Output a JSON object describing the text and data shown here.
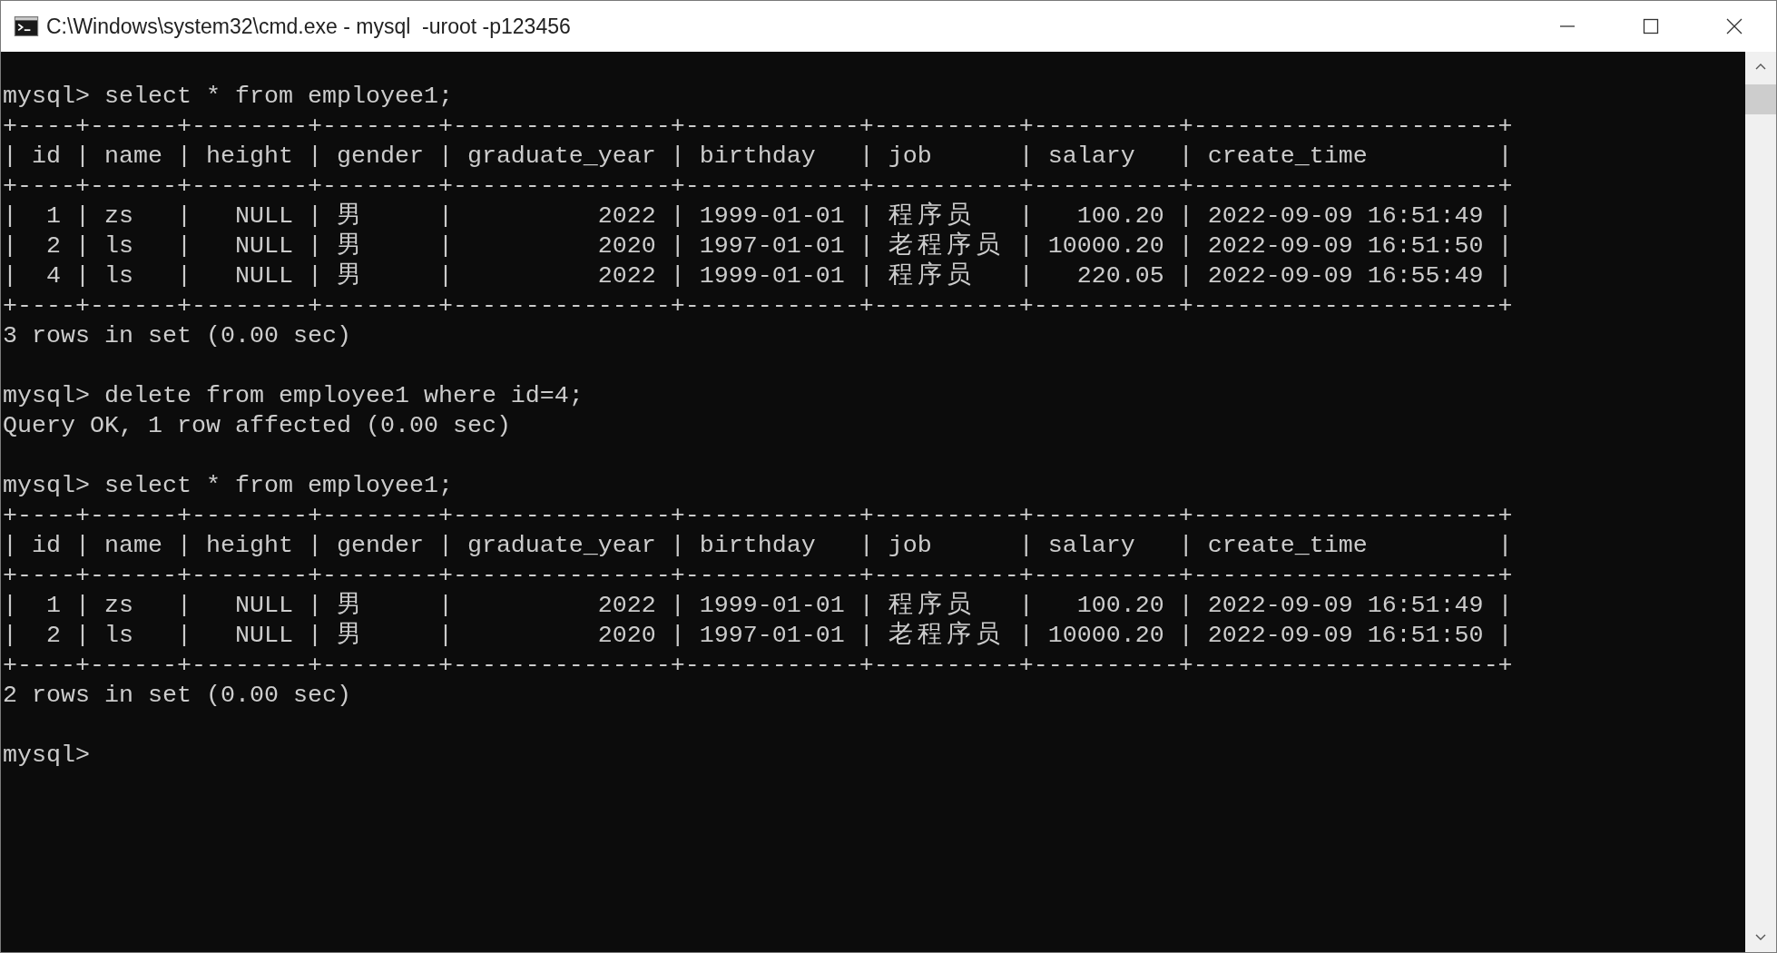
{
  "window": {
    "title": "C:\\Windows\\system32\\cmd.exe - mysql  -uroot -p123456"
  },
  "terminal": {
    "blocks": [
      [
        "mysql> select * from employee1;",
        "+----+------+--------+--------+---------------+------------+----------+----------+---------------------+",
        "| id | name | height | gender | graduate_year | birthday   | job      | salary   | create_time         |",
        "+----+------+--------+--------+---------------+------------+----------+----------+---------------------+",
        "|  1 | zs   |   NULL | 男     |          2022 | 1999-01-01 | 程序员   |   100.20 | 2022-09-09 16:51:49 |",
        "|  2 | ls   |   NULL | 男     |          2020 | 1997-01-01 | 老程序员 | 10000.20 | 2022-09-09 16:51:50 |",
        "|  4 | ls   |   NULL | 男     |          2022 | 1999-01-01 | 程序员   |   220.05 | 2022-09-09 16:55:49 |",
        "+----+------+--------+--------+---------------+------------+----------+----------+---------------------+",
        "3 rows in set (0.00 sec)"
      ],
      [
        "mysql> delete from employee1 where id=4;",
        "Query OK, 1 row affected (0.00 sec)"
      ],
      [
        "mysql> select * from employee1;",
        "+----+------+--------+--------+---------------+------------+----------+----------+---------------------+",
        "| id | name | height | gender | graduate_year | birthday   | job      | salary   | create_time         |",
        "+----+------+--------+--------+---------------+------------+----------+----------+---------------------+",
        "|  1 | zs   |   NULL | 男     |          2022 | 1999-01-01 | 程序员   |   100.20 | 2022-09-09 16:51:49 |",
        "|  2 | ls   |   NULL | 男     |          2020 | 1997-01-01 | 老程序员 | 10000.20 | 2022-09-09 16:51:50 |",
        "+----+------+--------+--------+---------------+------------+----------+----------+---------------------+",
        "2 rows in set (0.00 sec)"
      ],
      [
        "mysql>"
      ]
    ]
  }
}
